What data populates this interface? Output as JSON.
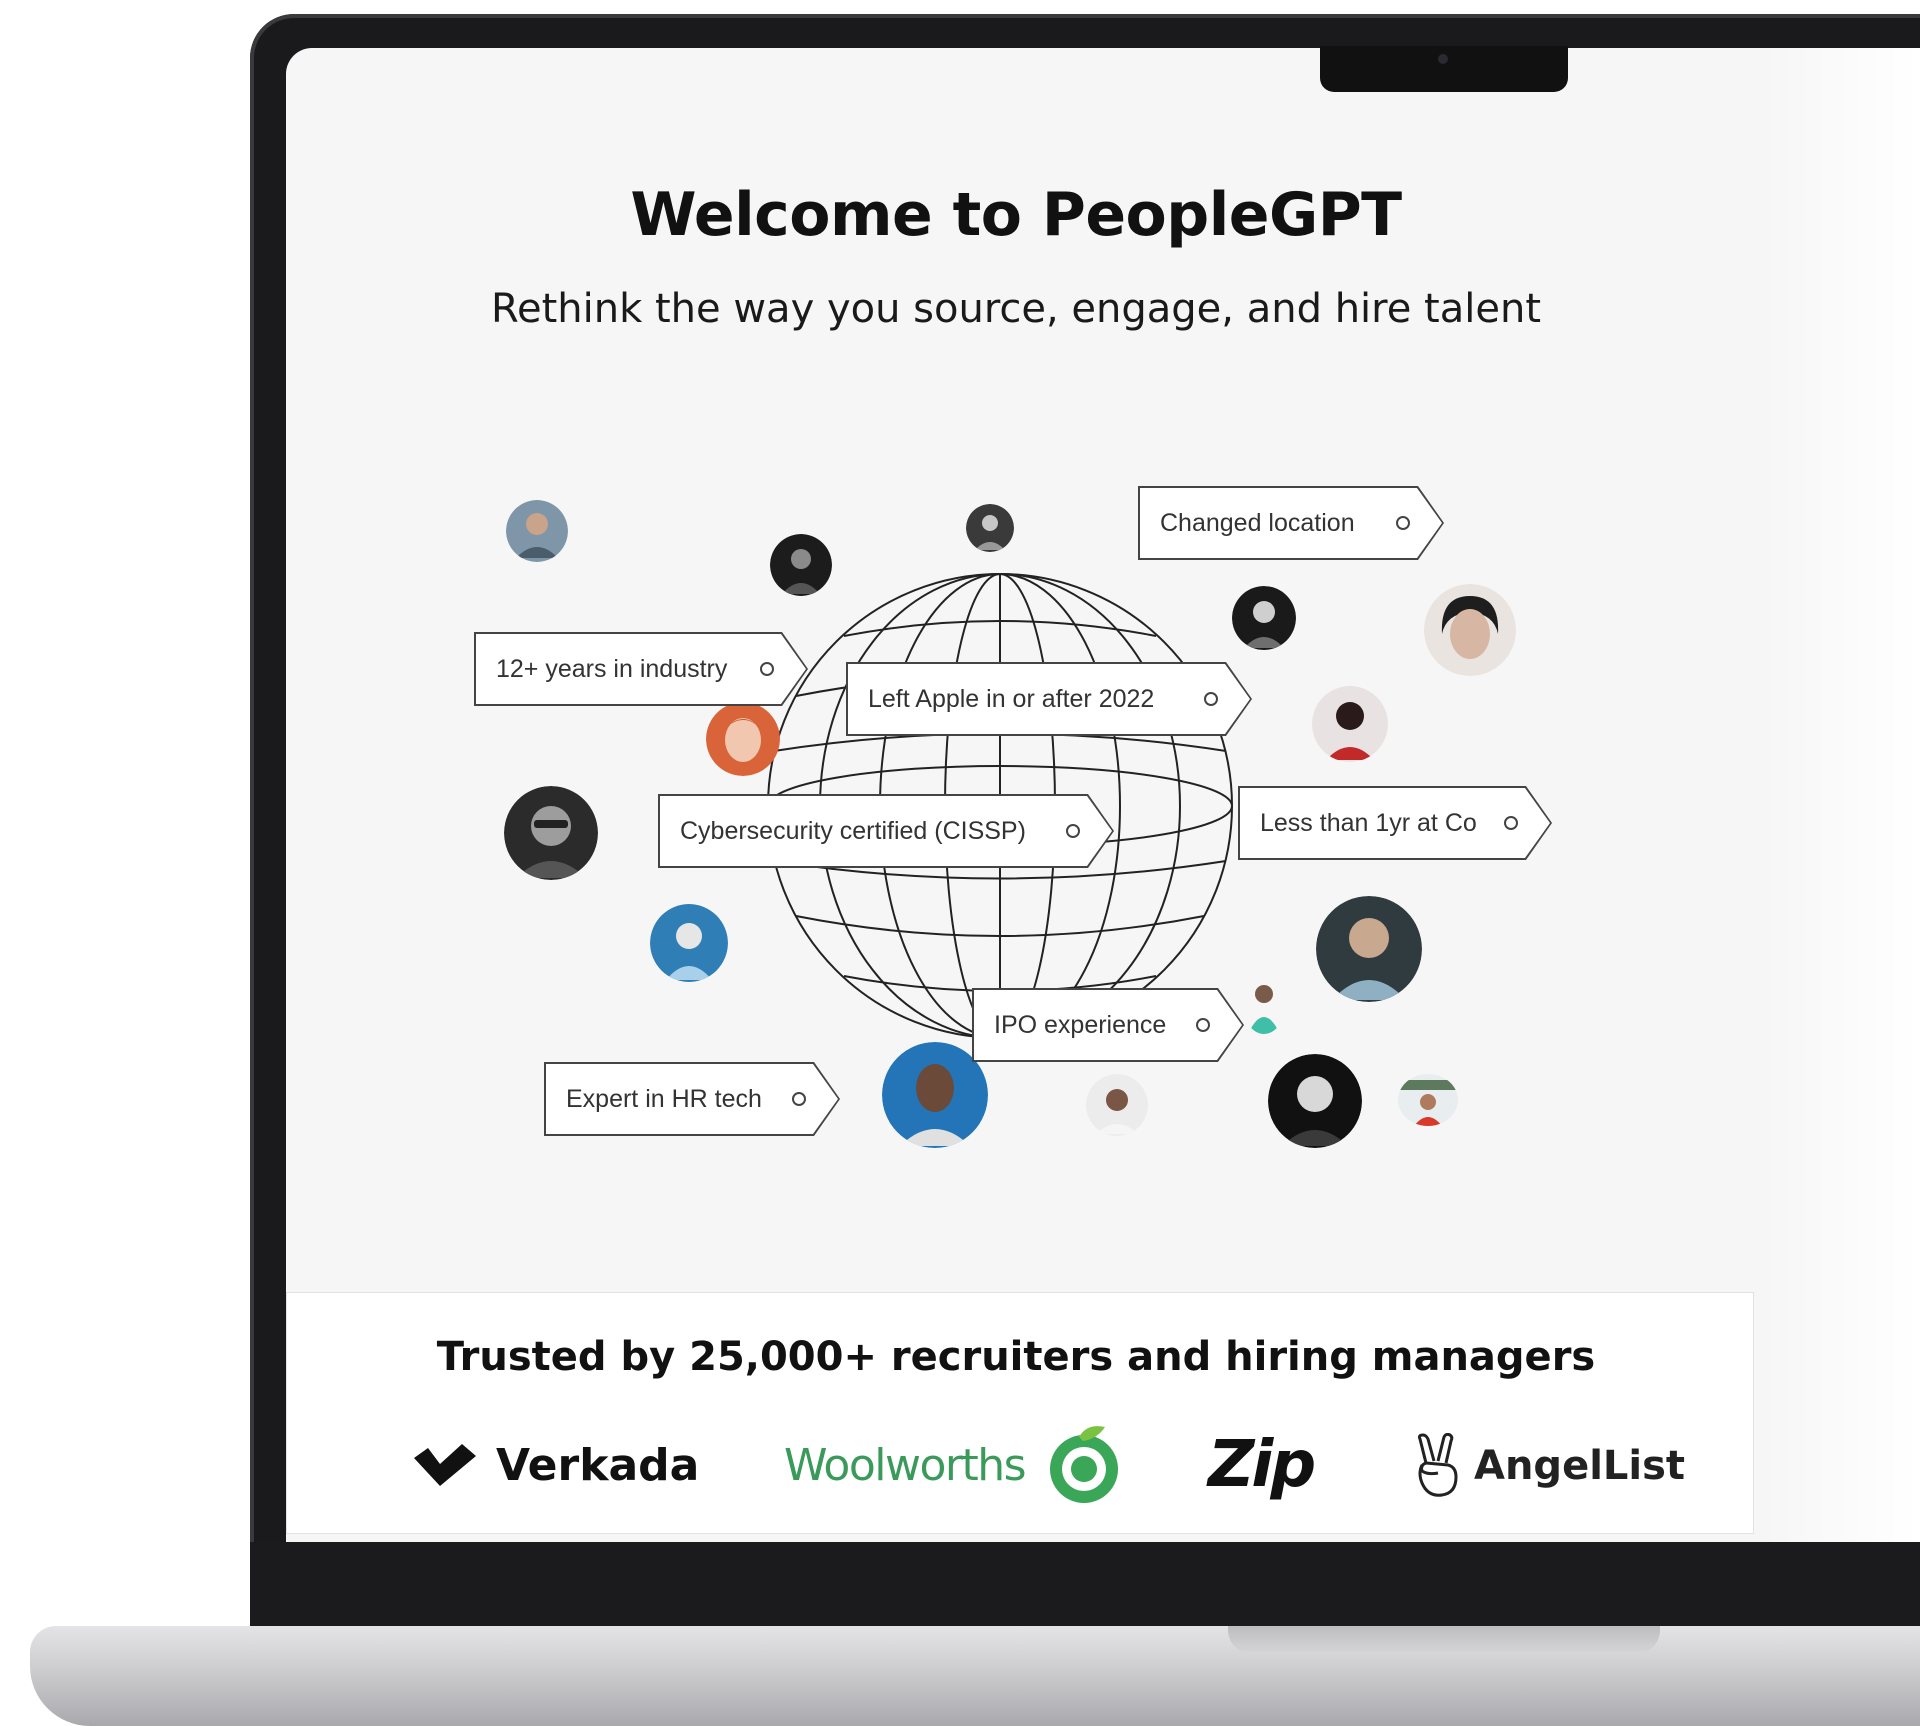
{
  "header": {
    "title": "Welcome to PeopleGPT",
    "subtitle": "Rethink the way you source, engage, and hire talent"
  },
  "filter_tags": [
    {
      "label": "Changed location"
    },
    {
      "label": "12+ years in industry"
    },
    {
      "label": "Left Apple in or after 2022"
    },
    {
      "label": "Cybersecurity certified (CISSP)"
    },
    {
      "label": "Less than 1yr at Co"
    },
    {
      "label": "IPO experience"
    },
    {
      "label": "Expert in HR tech"
    }
  ],
  "trusted": {
    "text": "Trusted by 25,000+ recruiters and hiring managers",
    "logos": [
      {
        "name": "Verkada",
        "icon": "verkada-check-icon",
        "color": "#111111"
      },
      {
        "name": "Woolworths",
        "icon": "woolworths-apple-icon",
        "color": "#2e8b57"
      },
      {
        "name": "Zip",
        "icon": "zip-wordmark",
        "color": "#111111"
      },
      {
        "name": "AngelList",
        "icon": "victory-hand-icon",
        "color": "#222222"
      }
    ]
  },
  "colors": {
    "screen_bg": "#f6f6f6",
    "bezel": "#1a1a1c",
    "tag_border": "#444444",
    "woolworths_green": "#3aa657"
  }
}
